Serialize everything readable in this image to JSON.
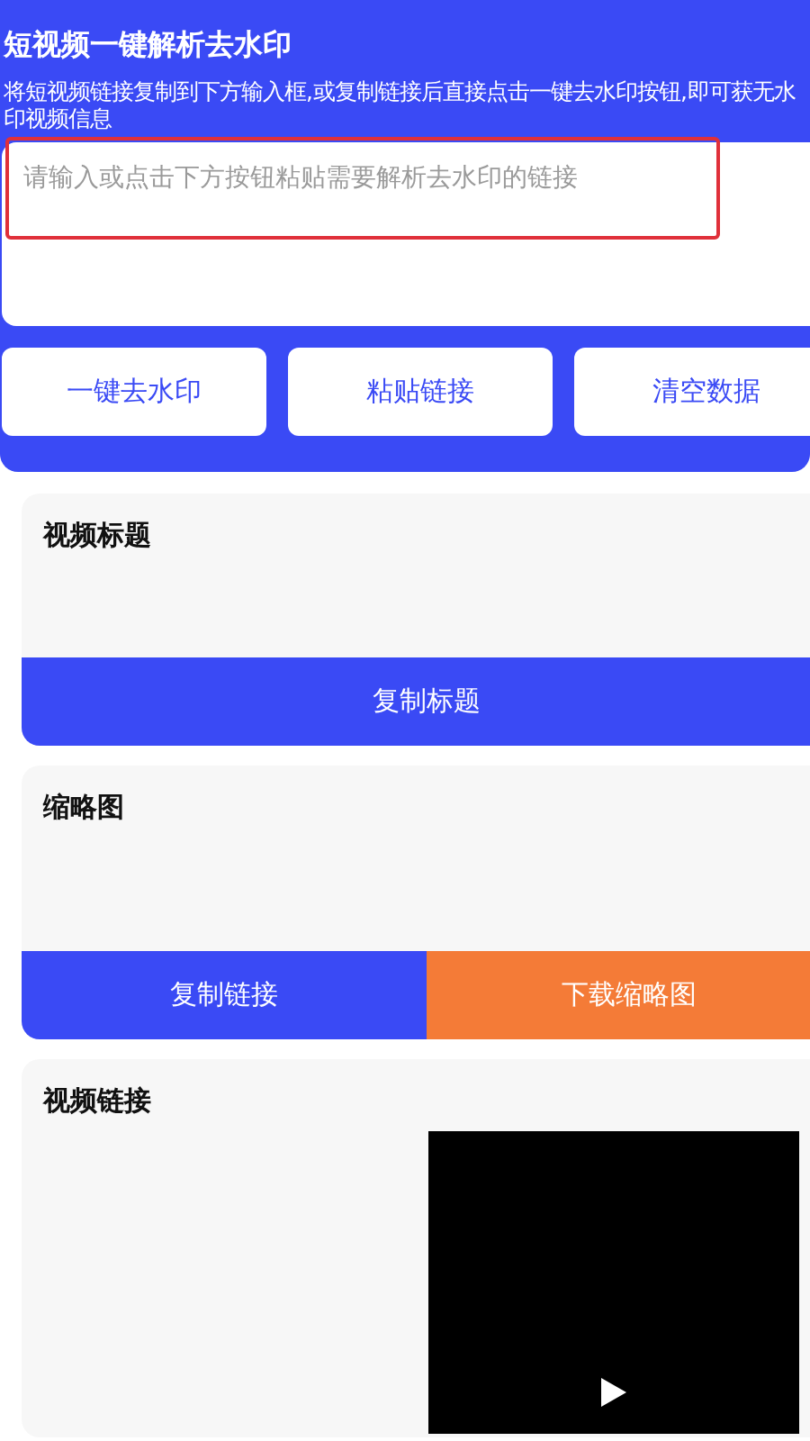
{
  "header": {
    "title": "短视频一键解析去水印",
    "description": "将短视频链接复制到下方输入框,或复制链接后直接点击一键去水印按钮,即可获无水印视频信息"
  },
  "input": {
    "placeholder": "请输入或点击下方按钮粘贴需要解析去水印的链接",
    "highlighted": true
  },
  "actions": [
    "一键去水印",
    "粘贴链接",
    "清空数据"
  ],
  "sections": [
    {
      "kind": "title",
      "heading": "视频标题",
      "buttons": [
        {
          "label": "复制标题",
          "color": "#3a4af5"
        }
      ]
    },
    {
      "kind": "thumbnail",
      "heading": "缩略图",
      "buttons": [
        {
          "label": "复制链接",
          "color": "#3a4af5"
        },
        {
          "label": "下载缩略图",
          "color": "#f47b37"
        }
      ]
    },
    {
      "kind": "video",
      "heading": "视频链接"
    }
  ]
}
